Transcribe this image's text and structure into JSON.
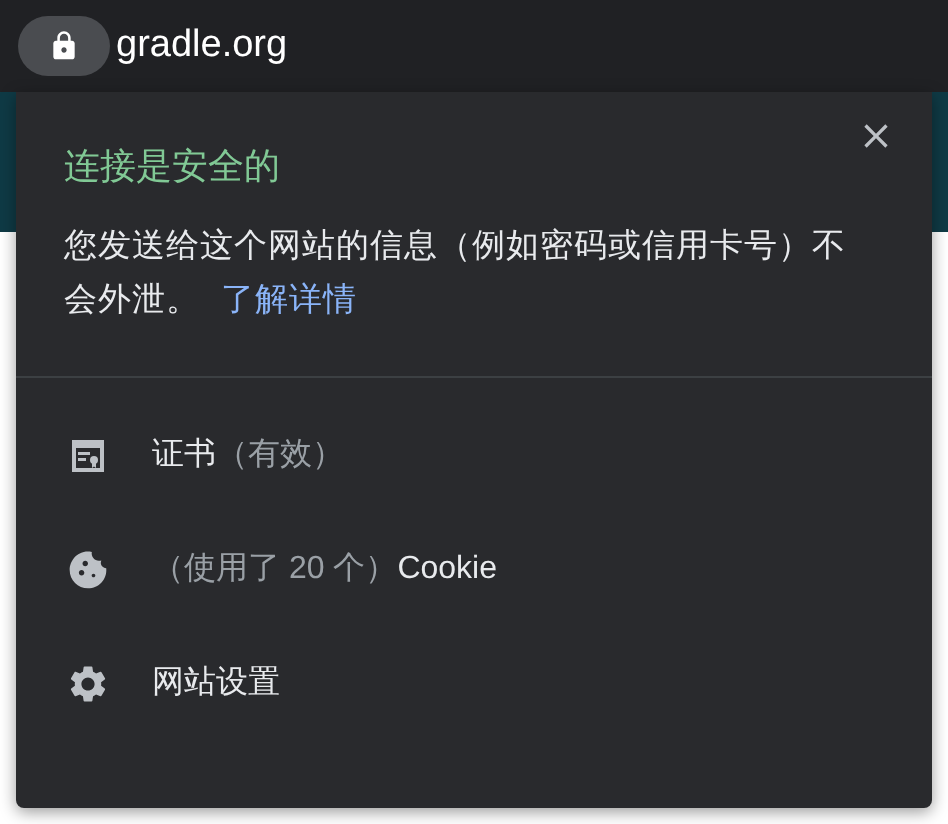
{
  "address_bar": {
    "url": "gradle.org"
  },
  "popup": {
    "title": "连接是安全的",
    "description": "您发送给这个网站的信息（例如密码或信用卡号）不会外泄。",
    "link": "了解详情",
    "items": [
      {
        "kind": "certificate",
        "parts": [
          {
            "text": "证书",
            "muted": false
          },
          {
            "text": "（有效）",
            "muted": true
          }
        ]
      },
      {
        "kind": "cookie",
        "parts": [
          {
            "text": "（使用了 20 个）",
            "muted": true
          },
          {
            "text": "Cookie",
            "muted": false
          }
        ]
      },
      {
        "kind": "settings",
        "parts": [
          {
            "text": "网站设置",
            "muted": false
          }
        ]
      }
    ]
  }
}
